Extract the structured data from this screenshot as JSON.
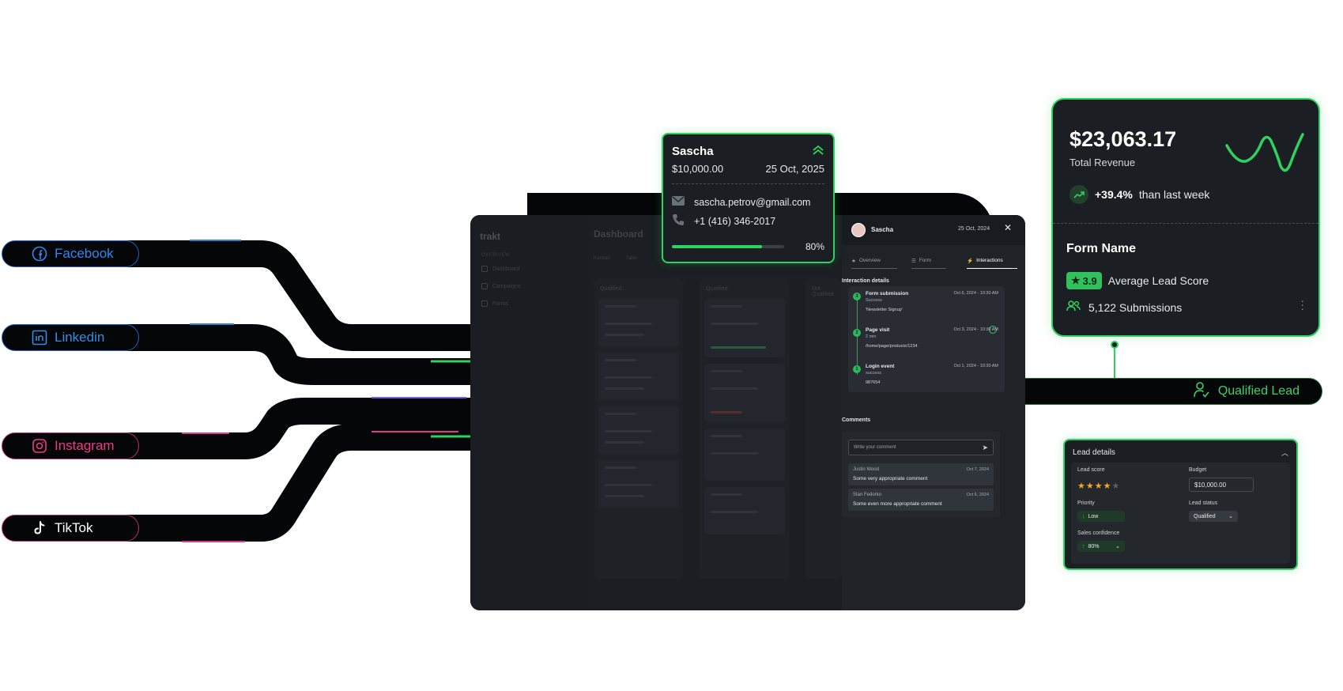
{
  "socials": {
    "facebook": "Facebook",
    "linkedin": "Linkedin",
    "instagram": "Instagram",
    "tiktok": "TikTok"
  },
  "app": {
    "logo": "trakt",
    "sidebar_section": "OVERVIEW",
    "sidebar_items": [
      "Dashboard",
      "Campaigns",
      "Forms"
    ],
    "title": "Dashboard",
    "tabs": [
      "Kanban",
      "Table"
    ],
    "columns": [
      "Qualified",
      "Qualified",
      "Not Qualified"
    ]
  },
  "panel": {
    "name": "Sascha",
    "date": "25 Oct, 2024",
    "tabs": [
      "Overview",
      "Form",
      "Interactions"
    ],
    "interaction_title": "Interaction details",
    "events": [
      {
        "num": "3",
        "title": "Form submission",
        "sub": "Success",
        "detail": "'Newsletter Signup'",
        "date": "Oct 6, 2024 - 10:30 AM"
      },
      {
        "num": "2",
        "title": "Page visit",
        "sub": "2 min",
        "detail": "/home/page/products/1234",
        "date": "Oct 3, 2024 - 10:30 AM"
      },
      {
        "num": "1",
        "title": "Login event",
        "sub": "success",
        "detail": "987654",
        "date": "Oct 1, 2024 - 10:30 AM"
      }
    ],
    "comments_title": "Comments",
    "comment_placeholder": "Write your comment",
    "comments": [
      {
        "author": "Justin Wood",
        "date": "Oct 7, 2024",
        "text": "Some very appropriate comment"
      },
      {
        "author": "Stan Fedorko",
        "date": "Oct 6, 2024",
        "text": "Some even more appropriate comment"
      }
    ]
  },
  "sascha_card": {
    "name": "Sascha",
    "amount": "$10,000.00",
    "date": "25 Oct, 2025",
    "email": "sascha.petrov@gmail.com",
    "phone": "+1 (416) 346-2017",
    "progress_pct": 80,
    "progress_label": "80%"
  },
  "revenue_card": {
    "amount": "$23,063.17",
    "label": "Total Revenue",
    "trend_value": "+39.4%",
    "trend_text": "than last week",
    "form_name": "Form Name",
    "score": "3.9",
    "score_label": "Average Lead Score",
    "submissions": "5,122 Submissions"
  },
  "qualified_lead": "Qualified Lead",
  "lead_details": {
    "title": "Lead details",
    "lead_score_label": "Lead score",
    "lead_score_stars": 4,
    "lead_score_max": 5,
    "budget_label": "Budget",
    "budget_value": "$10,000.00",
    "priority_label": "Priority",
    "priority_value": "Low",
    "status_label": "Lead status",
    "status_value": "Qualified",
    "confidence_label": "Sales confidence",
    "confidence_value": "80%"
  },
  "colors": {
    "accent_green": "#2fd160",
    "facebook_blue": "#3585f0",
    "instagram_pink": "#ec3b86",
    "star": "#f5a623"
  }
}
